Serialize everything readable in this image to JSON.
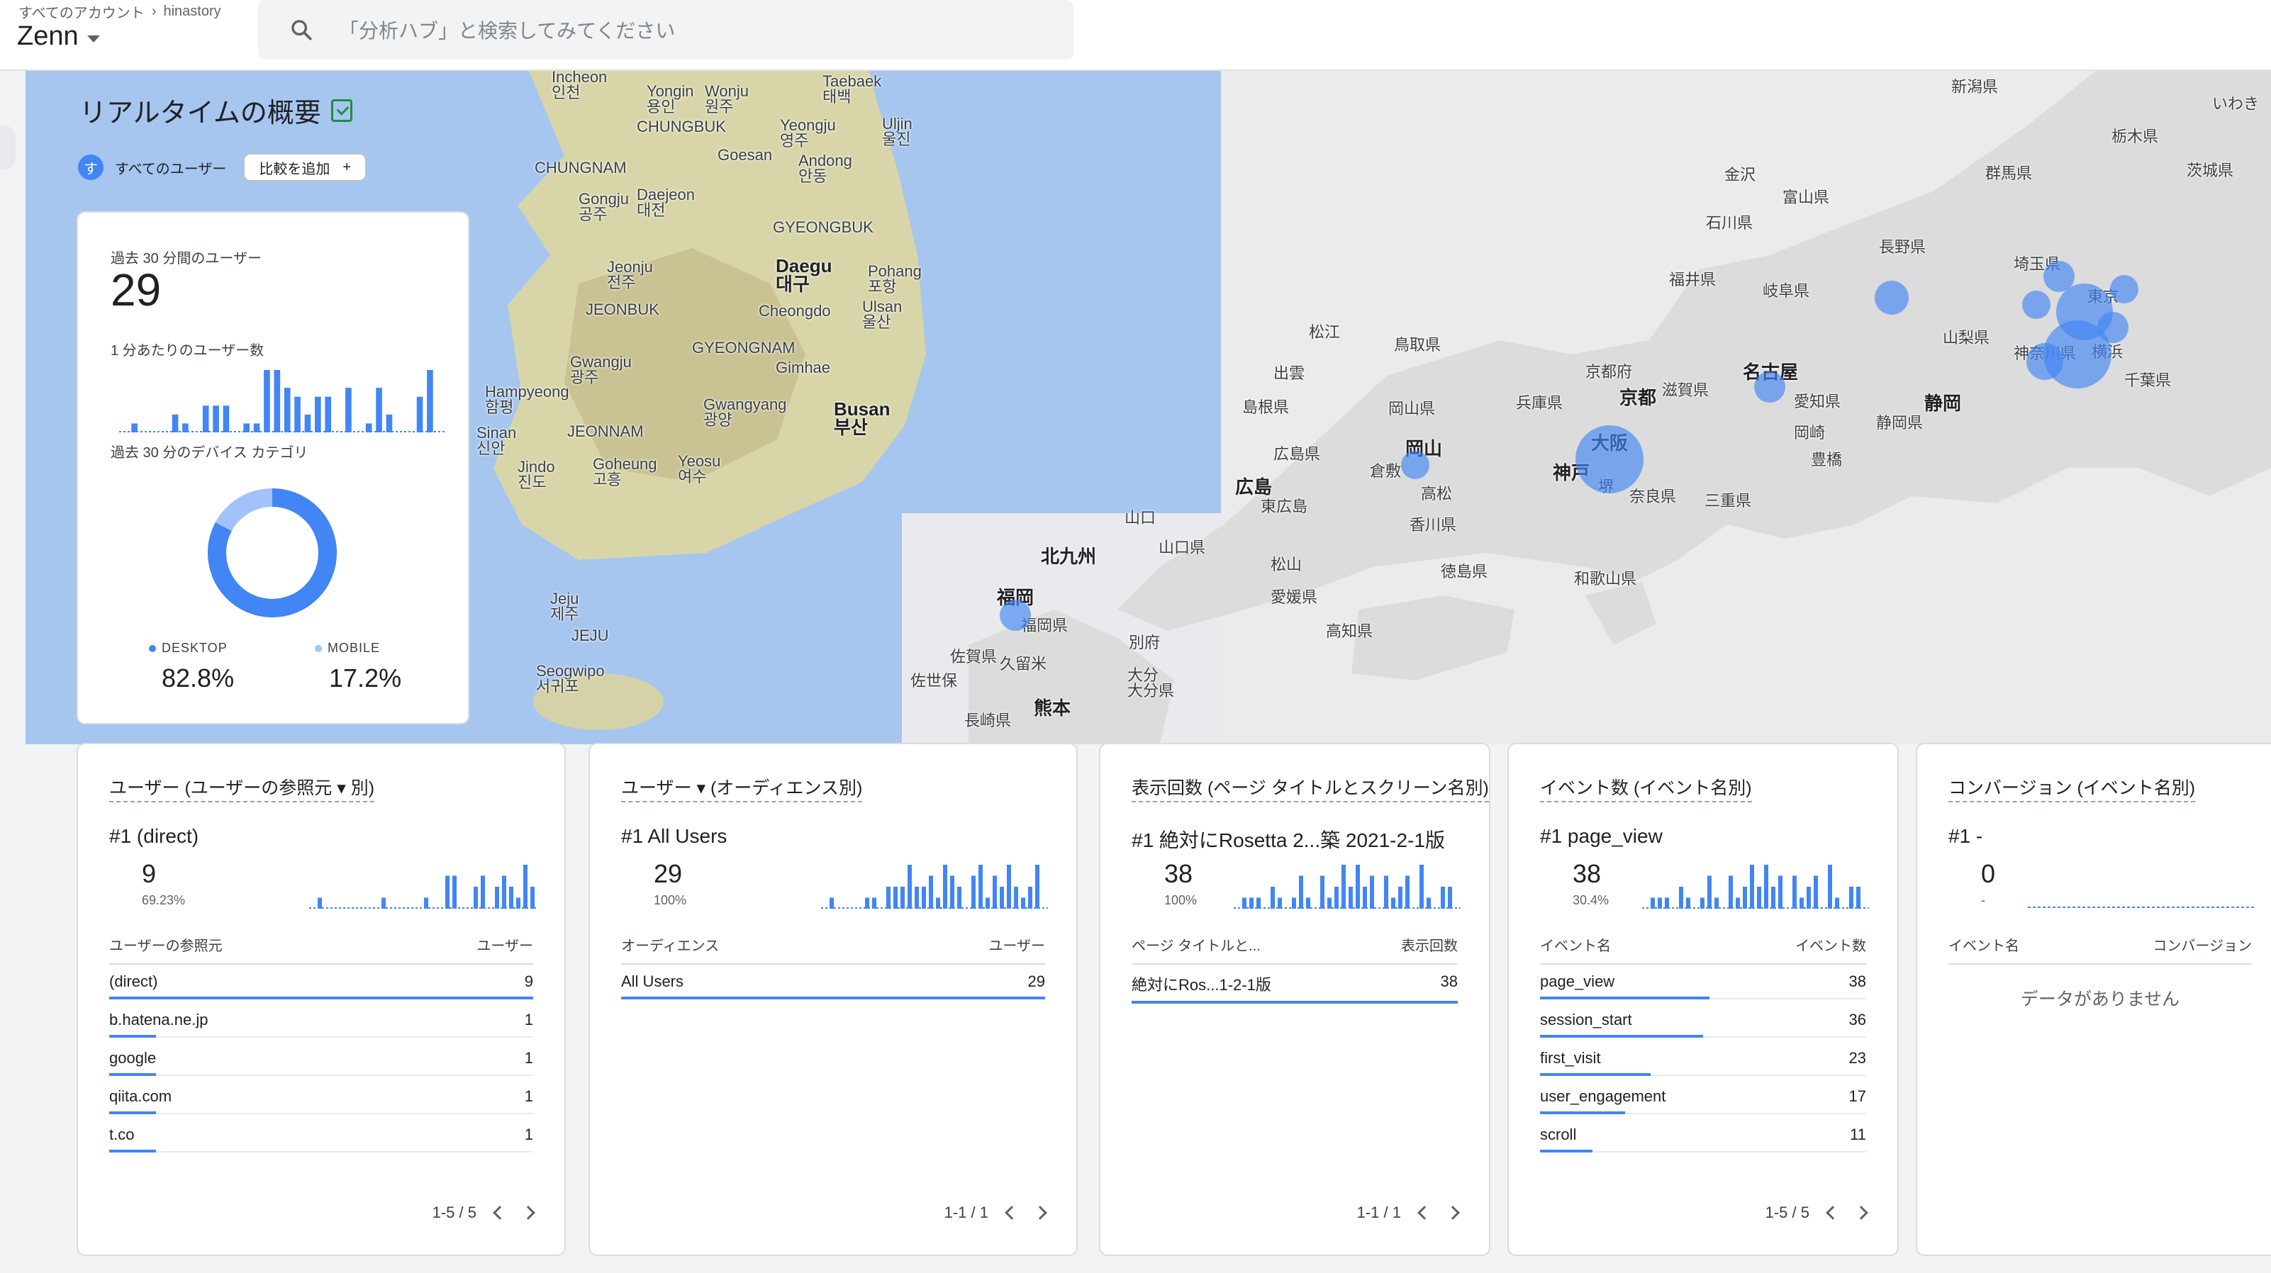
{
  "header": {
    "breadcrumb": [
      "すべてのアカウント",
      "hinastory"
    ],
    "property": "Zenn",
    "search_placeholder": "「分析ハブ」と検索してみてください"
  },
  "page": {
    "title": "リアルタイムの概要",
    "segment": "すべてのユーザー",
    "segment_initial": "す",
    "compare_label": "比較を追加"
  },
  "map": {
    "places": [
      [
        "Incheon\n인천",
        778,
        98
      ],
      [
        "Yongin\n용인",
        912,
        118
      ],
      [
        "Wonju\n원주",
        994,
        118
      ],
      [
        "Taebaek\n태백",
        1160,
        104
      ],
      [
        "Yeongju\n영주",
        1100,
        166
      ],
      [
        "Uljin\n울진",
        1244,
        164
      ],
      [
        "CHUNGBUK",
        898,
        168
      ],
      [
        "CHUNGNAM",
        754,
        226
      ],
      [
        "Goesan",
        1012,
        208
      ],
      [
        "Andong\n안동",
        1126,
        216
      ],
      [
        "Gongju\n공주",
        816,
        270
      ],
      [
        "Daejeon\n대전",
        898,
        264
      ],
      [
        "GYEONGBUK",
        1090,
        310
      ],
      [
        "Daegu\n대구",
        1094,
        362
      ],
      [
        "Pohang\n포항",
        1224,
        372
      ],
      [
        "Jeonju\n전주",
        856,
        366
      ],
      [
        "JEONBUK",
        826,
        426
      ],
      [
        "Cheongdo",
        1070,
        428
      ],
      [
        "Ulsan\n울산",
        1216,
        422
      ],
      [
        "GYEONGNAM",
        976,
        480
      ],
      [
        "Gwangju\n광주",
        804,
        500
      ],
      [
        "Gimhae",
        1094,
        508
      ],
      [
        "Hampyeong\n함평",
        684,
        542
      ],
      [
        "Gwangyang\n광양",
        992,
        560
      ],
      [
        "Busan\n부산",
        1176,
        564
      ],
      [
        "JEONNAM",
        800,
        598
      ],
      [
        "Sinan\n신안",
        672,
        600
      ],
      [
        "Goheung\n고흥",
        836,
        644
      ],
      [
        "Yeosu\n여수",
        956,
        640
      ],
      [
        "Jindo\n진도",
        730,
        648
      ],
      [
        "Jeju\n제주",
        776,
        834
      ],
      [
        "JEJU",
        806,
        886
      ],
      [
        "Seogwipo\n서귀포",
        756,
        936
      ],
      [
        "新潟県",
        2752,
        112
      ],
      [
        "いわき",
        3120,
        136
      ],
      [
        "栃木県",
        2978,
        182
      ],
      [
        "茨城県",
        3084,
        230
      ],
      [
        "金沢",
        2432,
        236
      ],
      [
        "富山県",
        2514,
        268
      ],
      [
        "群馬県",
        2800,
        234
      ],
      [
        "石川県",
        2406,
        304
      ],
      [
        "長野県",
        2650,
        338
      ],
      [
        "埼玉県",
        2840,
        362
      ],
      [
        "福井県",
        2354,
        384
      ],
      [
        "岐阜県",
        2486,
        400
      ],
      [
        "東京",
        2944,
        408
      ],
      [
        "松江",
        1846,
        458
      ],
      [
        "鳥取県",
        1966,
        476
      ],
      [
        "山梨県",
        2740,
        466
      ],
      [
        "神奈川県",
        2840,
        488
      ],
      [
        "横浜",
        2950,
        486
      ],
      [
        "出雲",
        1796,
        516
      ],
      [
        "京都府",
        2236,
        514
      ],
      [
        "京都",
        2284,
        548
      ],
      [
        "滋賀県",
        2344,
        540
      ],
      [
        "名古屋",
        2458,
        512
      ],
      [
        "千葉県",
        2996,
        526
      ],
      [
        "兵庫県",
        2138,
        558
      ],
      [
        "岡山県",
        1958,
        566
      ],
      [
        "島根県",
        1752,
        564
      ],
      [
        "愛知県",
        2530,
        556
      ],
      [
        "静岡",
        2714,
        556
      ],
      [
        "静岡県",
        2646,
        586
      ],
      [
        "岡崎",
        2530,
        600
      ],
      [
        "大阪",
        2244,
        612
      ],
      [
        "岡山",
        1982,
        620
      ],
      [
        "豊橋",
        2554,
        638
      ],
      [
        "広島県",
        1796,
        630
      ],
      [
        "倉敷",
        1932,
        654
      ],
      [
        "神戸",
        2190,
        654
      ],
      [
        "広島",
        1742,
        674
      ],
      [
        "堺",
        2254,
        676
      ],
      [
        "高松",
        2004,
        686
      ],
      [
        "奈良県",
        2298,
        690
      ],
      [
        "三重県",
        2404,
        696
      ],
      [
        "東広島",
        1778,
        704
      ],
      [
        "香川県",
        1988,
        730
      ],
      [
        "山口",
        1586,
        720
      ],
      [
        "北九州",
        1468,
        772
      ],
      [
        "山口県",
        1634,
        762
      ],
      [
        "松山",
        1792,
        786
      ],
      [
        "徳島県",
        2032,
        796
      ],
      [
        "和歌山県",
        2220,
        806
      ],
      [
        "福岡",
        1406,
        830
      ],
      [
        "愛媛県",
        1792,
        832
      ],
      [
        "福岡県",
        1440,
        872
      ],
      [
        "高知県",
        1870,
        880
      ],
      [
        "別府",
        1592,
        896
      ],
      [
        "佐賀県",
        1340,
        916
      ],
      [
        "久留米",
        1410,
        926
      ],
      [
        "大分\n大分県",
        1590,
        942
      ],
      [
        "佐世保",
        1284,
        950
      ],
      [
        "熊本",
        1458,
        986
      ],
      [
        "長崎県",
        1360,
        1006
      ]
    ],
    "big_places": [
      "Busan\n부산",
      "Daegu\n대구",
      "大阪",
      "名古屋",
      "京都",
      "静岡",
      "岡山",
      "広島",
      "神戸",
      "北九州",
      "福岡",
      "熊本"
    ],
    "bubbles": [
      [
        2668,
        420,
        24
      ],
      [
        1996,
        656,
        20
      ],
      [
        2496,
        546,
        22
      ],
      [
        2270,
        648,
        48
      ],
      [
        1432,
        868,
        22
      ],
      [
        2904,
        390,
        22
      ],
      [
        2940,
        440,
        40
      ],
      [
        2996,
        408,
        20
      ],
      [
        2872,
        430,
        20
      ],
      [
        2930,
        500,
        48
      ],
      [
        2884,
        510,
        26
      ],
      [
        2980,
        462,
        22
      ]
    ]
  },
  "summary": {
    "users_label": "過去 30 分間のユーザー",
    "users_value": "29",
    "per_min_label": "1 分あたりのユーザー数",
    "per_min": [
      0,
      1,
      0,
      0,
      0,
      2,
      1,
      0,
      3,
      3,
      3,
      0,
      1,
      1,
      7,
      7,
      5,
      4,
      2,
      4,
      4,
      0,
      5,
      0,
      1,
      5,
      2,
      0,
      0,
      4,
      7,
      0
    ],
    "device_label": "過去 30 分のデバイス カテゴリ",
    "devices": [
      {
        "name": "DESKTOP",
        "pct": "82.8%",
        "value": 82.8
      },
      {
        "name": "MOBILE",
        "pct": "17.2%",
        "value": 17.2
      }
    ],
    "colors": {
      "desktop": "#4285f4",
      "mobile": "#a1c2fa"
    }
  },
  "cards": [
    {
      "title": "ユーザー (ユーザーの参照元 ▾ 別)",
      "top_label": "#1 (direct)",
      "top_value": "9",
      "top_pct": "69.23%",
      "spark": [
        0,
        1,
        0,
        0,
        0,
        0,
        0,
        0,
        0,
        0,
        1,
        0,
        0,
        0,
        0,
        0,
        1,
        0,
        0,
        3,
        3,
        0,
        0,
        2,
        3,
        0,
        2,
        3,
        2,
        1,
        4,
        2
      ],
      "col_left": "ユーザーの参照元",
      "col_right": "ユーザー",
      "rows": [
        {
          "label": "(direct)",
          "value": "9",
          "ratio": 1.0
        },
        {
          "label": "b.hatena.ne.jp",
          "value": "1",
          "ratio": 0.11
        },
        {
          "label": "google",
          "value": "1",
          "ratio": 0.11
        },
        {
          "label": "qiita.com",
          "value": "1",
          "ratio": 0.11
        },
        {
          "label": "t.co",
          "value": "1",
          "ratio": 0.11
        }
      ],
      "pager": "1-5 / 5",
      "empty": ""
    },
    {
      "title": "ユーザー ▾ (オーディエンス別)",
      "top_label": "#1 All Users",
      "top_value": "29",
      "top_pct": "100%",
      "spark": [
        0,
        1,
        0,
        0,
        0,
        0,
        1,
        1,
        0,
        2,
        2,
        2,
        4,
        2,
        2,
        3,
        1,
        4,
        3,
        2,
        0,
        3,
        4,
        1,
        3,
        2,
        4,
        2,
        1,
        2,
        4,
        0
      ],
      "col_left": "オーディエンス",
      "col_right": "ユーザー",
      "rows": [
        {
          "label": "All Users",
          "value": "29",
          "ratio": 1.0
        }
      ],
      "pager": "1-1 / 1",
      "empty": ""
    },
    {
      "title": "表示回数 (ページ タイトルとスクリーン名別)",
      "top_label": "#1 絶対にRosetta 2...築 2021-2-1版",
      "top_value": "38",
      "top_pct": "100%",
      "spark": [
        0,
        1,
        1,
        1,
        0,
        2,
        1,
        0,
        1,
        3,
        1,
        0,
        3,
        1,
        2,
        4,
        2,
        4,
        2,
        3,
        0,
        3,
        1,
        2,
        3,
        0,
        4,
        1,
        0,
        2,
        2,
        0
      ],
      "col_left": "ページ タイトルと...",
      "col_right": "表示回数",
      "rows": [
        {
          "label": "絶対にRos...1-2-1版",
          "value": "38",
          "ratio": 1.0
        }
      ],
      "pager": "1-1 / 1",
      "empty": ""
    },
    {
      "title": "イベント数 (イベント名別)",
      "top_label": "#1 page_view",
      "top_value": "38",
      "top_pct": "30.4%",
      "spark": [
        0,
        1,
        1,
        1,
        0,
        2,
        1,
        0,
        1,
        3,
        1,
        0,
        3,
        1,
        2,
        4,
        2,
        4,
        2,
        3,
        0,
        3,
        1,
        2,
        3,
        0,
        4,
        1,
        0,
        2,
        2,
        0
      ],
      "col_left": "イベント名",
      "col_right": "イベント数",
      "rows": [
        {
          "label": "page_view",
          "value": "38",
          "ratio": 0.52
        },
        {
          "label": "session_start",
          "value": "36",
          "ratio": 0.5
        },
        {
          "label": "first_visit",
          "value": "23",
          "ratio": 0.34
        },
        {
          "label": "user_engagement",
          "value": "17",
          "ratio": 0.26
        },
        {
          "label": "scroll",
          "value": "11",
          "ratio": 0.16
        }
      ],
      "pager": "1-5 / 5",
      "empty": ""
    },
    {
      "title": "コンバージョン (イベント名別)",
      "top_label": "#1 -",
      "top_value": "0",
      "top_pct": "-",
      "spark": [],
      "col_left": "イベント名",
      "col_right": "コンバージョン",
      "rows": [],
      "pager": "",
      "empty": "データがありません"
    }
  ]
}
